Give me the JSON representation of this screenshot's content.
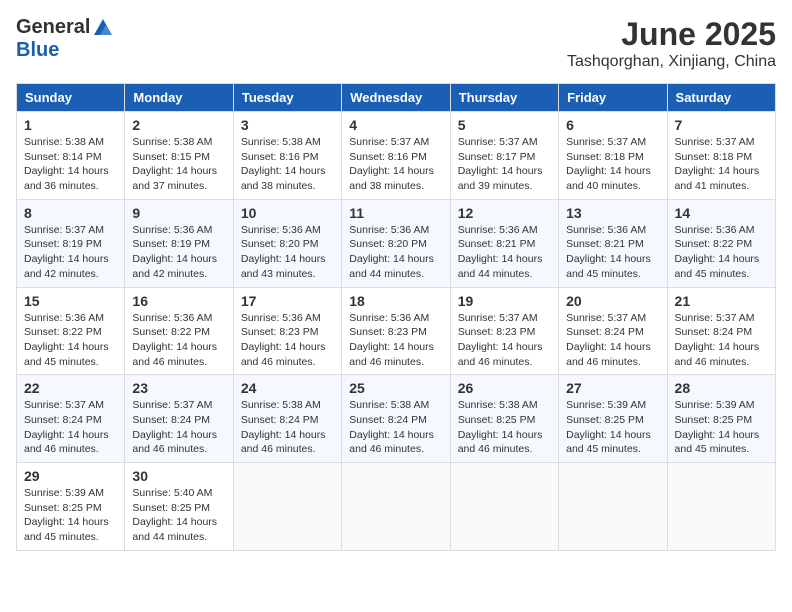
{
  "header": {
    "logo_general": "General",
    "logo_blue": "Blue",
    "title": "June 2025",
    "subtitle": "Tashqorghan, Xinjiang, China"
  },
  "calendar": {
    "headers": [
      "Sunday",
      "Monday",
      "Tuesday",
      "Wednesday",
      "Thursday",
      "Friday",
      "Saturday"
    ],
    "weeks": [
      [
        null,
        {
          "day": "2",
          "sunrise": "5:38 AM",
          "sunset": "8:15 PM",
          "daylight": "14 hours and 37 minutes."
        },
        {
          "day": "3",
          "sunrise": "5:38 AM",
          "sunset": "8:16 PM",
          "daylight": "14 hours and 38 minutes."
        },
        {
          "day": "4",
          "sunrise": "5:37 AM",
          "sunset": "8:16 PM",
          "daylight": "14 hours and 38 minutes."
        },
        {
          "day": "5",
          "sunrise": "5:37 AM",
          "sunset": "8:17 PM",
          "daylight": "14 hours and 39 minutes."
        },
        {
          "day": "6",
          "sunrise": "5:37 AM",
          "sunset": "8:18 PM",
          "daylight": "14 hours and 40 minutes."
        },
        {
          "day": "7",
          "sunrise": "5:37 AM",
          "sunset": "8:18 PM",
          "daylight": "14 hours and 41 minutes."
        }
      ],
      [
        {
          "day": "1",
          "sunrise": "5:38 AM",
          "sunset": "8:14 PM",
          "daylight": "14 hours and 36 minutes."
        },
        {
          "day": "9",
          "sunrise": "5:36 AM",
          "sunset": "8:19 PM",
          "daylight": "14 hours and 42 minutes."
        },
        {
          "day": "10",
          "sunrise": "5:36 AM",
          "sunset": "8:20 PM",
          "daylight": "14 hours and 43 minutes."
        },
        {
          "day": "11",
          "sunrise": "5:36 AM",
          "sunset": "8:20 PM",
          "daylight": "14 hours and 44 minutes."
        },
        {
          "day": "12",
          "sunrise": "5:36 AM",
          "sunset": "8:21 PM",
          "daylight": "14 hours and 44 minutes."
        },
        {
          "day": "13",
          "sunrise": "5:36 AM",
          "sunset": "8:21 PM",
          "daylight": "14 hours and 45 minutes."
        },
        {
          "day": "14",
          "sunrise": "5:36 AM",
          "sunset": "8:22 PM",
          "daylight": "14 hours and 45 minutes."
        }
      ],
      [
        {
          "day": "8",
          "sunrise": "5:37 AM",
          "sunset": "8:19 PM",
          "daylight": "14 hours and 42 minutes."
        },
        {
          "day": "16",
          "sunrise": "5:36 AM",
          "sunset": "8:22 PM",
          "daylight": "14 hours and 46 minutes."
        },
        {
          "day": "17",
          "sunrise": "5:36 AM",
          "sunset": "8:23 PM",
          "daylight": "14 hours and 46 minutes."
        },
        {
          "day": "18",
          "sunrise": "5:36 AM",
          "sunset": "8:23 PM",
          "daylight": "14 hours and 46 minutes."
        },
        {
          "day": "19",
          "sunrise": "5:37 AM",
          "sunset": "8:23 PM",
          "daylight": "14 hours and 46 minutes."
        },
        {
          "day": "20",
          "sunrise": "5:37 AM",
          "sunset": "8:24 PM",
          "daylight": "14 hours and 46 minutes."
        },
        {
          "day": "21",
          "sunrise": "5:37 AM",
          "sunset": "8:24 PM",
          "daylight": "14 hours and 46 minutes."
        }
      ],
      [
        {
          "day": "15",
          "sunrise": "5:36 AM",
          "sunset": "8:22 PM",
          "daylight": "14 hours and 45 minutes."
        },
        {
          "day": "23",
          "sunrise": "5:37 AM",
          "sunset": "8:24 PM",
          "daylight": "14 hours and 46 minutes."
        },
        {
          "day": "24",
          "sunrise": "5:38 AM",
          "sunset": "8:24 PM",
          "daylight": "14 hours and 46 minutes."
        },
        {
          "day": "25",
          "sunrise": "5:38 AM",
          "sunset": "8:24 PM",
          "daylight": "14 hours and 46 minutes."
        },
        {
          "day": "26",
          "sunrise": "5:38 AM",
          "sunset": "8:25 PM",
          "daylight": "14 hours and 46 minutes."
        },
        {
          "day": "27",
          "sunrise": "5:39 AM",
          "sunset": "8:25 PM",
          "daylight": "14 hours and 45 minutes."
        },
        {
          "day": "28",
          "sunrise": "5:39 AM",
          "sunset": "8:25 PM",
          "daylight": "14 hours and 45 minutes."
        }
      ],
      [
        {
          "day": "22",
          "sunrise": "5:37 AM",
          "sunset": "8:24 PM",
          "daylight": "14 hours and 46 minutes."
        },
        {
          "day": "30",
          "sunrise": "5:40 AM",
          "sunset": "8:25 PM",
          "daylight": "14 hours and 44 minutes."
        },
        null,
        null,
        null,
        null,
        null
      ],
      [
        {
          "day": "29",
          "sunrise": "5:39 AM",
          "sunset": "8:25 PM",
          "daylight": "14 hours and 45 minutes."
        },
        null,
        null,
        null,
        null,
        null,
        null
      ]
    ]
  }
}
